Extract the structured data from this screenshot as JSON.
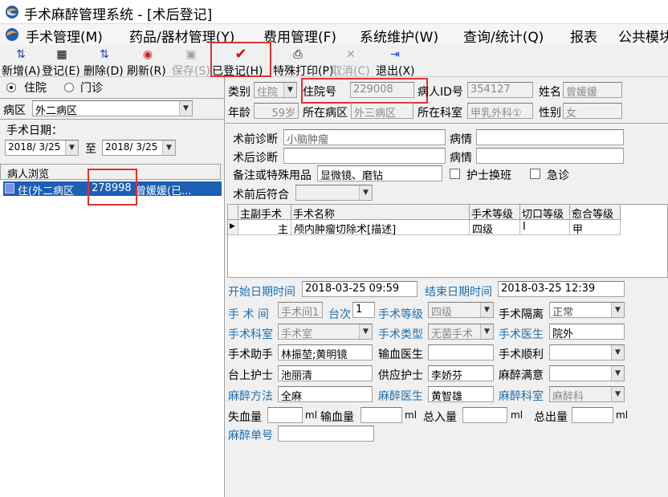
{
  "window": {
    "title": "手术麻醉管理系统 - [术后登记]"
  },
  "menu": [
    "手术管理(M)",
    "药品/器材管理(Y)",
    "费用管理(F)",
    "系统维护(W)",
    "查询/统计(Q)",
    "报表",
    "公共模块"
  ],
  "toolbar": {
    "new": "新增(A)",
    "register": "登记(E)",
    "delete": "删除(D)",
    "refresh": "刷新(R)",
    "save": "保存(S)",
    "registered": "已登记(H)",
    "special_print": "特殊打印(P)",
    "cancel": "取消(C)",
    "exit": "退出(X)"
  },
  "left": {
    "inpatient": "住院",
    "outpatient": "门诊",
    "ward_label": "病区",
    "ward_value": "外二病区",
    "date_label": "手术日期：",
    "date_from": "2018/ 3/25",
    "date_to_label": "至",
    "date_to": "2018/ 3/25",
    "browse_header": "病人浏览",
    "patient_prefix": "住(外二病区",
    "patient_id": "278998",
    "patient_suffix": "曾媛媛(已..."
  },
  "patient": {
    "type_label": "类别",
    "type_value": "住院",
    "hosp_no_label": "住院号",
    "hosp_no_value": "229008",
    "pid_label": "病人ID号",
    "pid_value": "354127",
    "name_label": "姓名",
    "name_value": "曾媛媛",
    "age_label": "年龄",
    "age_value": "59岁",
    "ward_label": "所在病区",
    "ward_value": "外三病区",
    "dept_label": "所在科室",
    "dept_value": "甲乳外科①",
    "sex_label": "性别",
    "sex_value": "女"
  },
  "diag": {
    "pre_label": "术前诊断",
    "pre_value": "小脑肿瘤",
    "cond1_label": "病情",
    "cond1_value": "",
    "post_label": "术后诊断",
    "post_value": "",
    "cond2_label": "病情",
    "cond2_value": "",
    "notes_label": "备注或特殊用品",
    "notes_value": "显微镜、磨钻",
    "nurse_swap": "护士换班",
    "emergency": "急诊",
    "match_label": "术前后符合",
    "match_value": ""
  },
  "surgery_grid": {
    "columns": [
      "主副手术",
      "手术名称",
      "手术等级",
      "切口等级",
      "愈合等级"
    ],
    "rows": [
      [
        "主",
        "颅内肿瘤切除术[描述]",
        "四级",
        "Ⅰ",
        "甲"
      ]
    ]
  },
  "details": {
    "start_label": "开始日期时间",
    "start_value": "2018-03-25 09:59",
    "end_label": "结束日期时间",
    "end_value": "2018-03-25 12:39",
    "room_label": "手 术 间",
    "room_value": "手术间1",
    "seq_label": "台次",
    "seq_value": "1",
    "level_label": "手术等级",
    "level_value": "四级",
    "isolation_label": "手术隔离",
    "isolation_value": "正常",
    "sdept_label": "手术科室",
    "sdept_value": "手术室",
    "stype_label": "手术类型",
    "stype_value": "无菌手术",
    "doctor_label": "手术医生",
    "doctor_value": "院外",
    "assistant_label": "手术助手",
    "assistant_value": "林振堃;黄明镜",
    "transfusion_doc_label": "输血医生",
    "transfusion_doc_value": "",
    "smooth_label": "手术顺利",
    "smooth_value": "",
    "onsite_nurse_label": "台上护士",
    "onsite_nurse_value": "池丽清",
    "supply_nurse_label": "供应护士",
    "supply_nurse_value": "李娇芬",
    "anes_satisfied_label": "麻醉满意",
    "anes_satisfied_value": "",
    "anes_method_label": "麻醉方法",
    "anes_method_value": "全麻",
    "anes_doc_label": "麻醉医生",
    "anes_doc_value": "黄智雄",
    "anes_dept_label": "麻醉科室",
    "anes_dept_value": "麻醉科",
    "blood_loss_label": "失血量",
    "ml": "ml",
    "transfusion_label": "输血量",
    "intake_label": "总入量",
    "output_label": "总出量",
    "anes_no_label": "麻醉单号",
    "anes_no_value": ""
  }
}
